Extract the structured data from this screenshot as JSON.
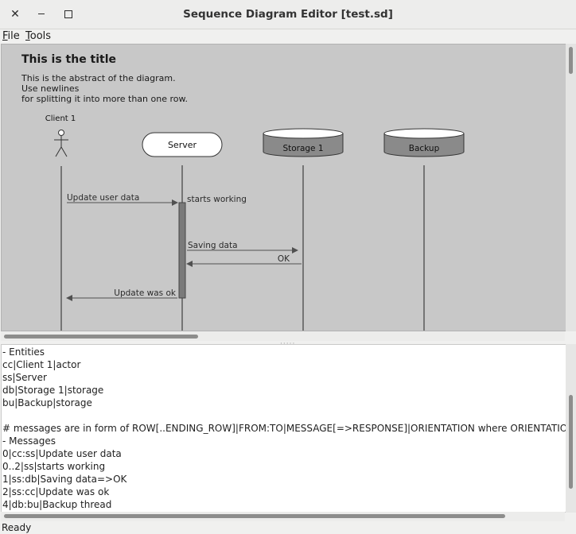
{
  "window": {
    "title": "Sequence Diagram Editor [test.sd]"
  },
  "menu": {
    "file": "File",
    "tools": "Tools"
  },
  "diagram": {
    "title": "This is the title",
    "abstract": [
      "This is the abstract of the diagram.",
      "Use newlines",
      "for splitting it into more than one row."
    ],
    "entities": [
      {
        "label": "Client 1",
        "type": "actor"
      },
      {
        "label": "Server",
        "type": "process"
      },
      {
        "label": "Storage 1",
        "type": "storage"
      },
      {
        "label": "Backup",
        "type": "storage"
      }
    ],
    "messages": [
      "Update user data",
      "starts working",
      "Saving data",
      "OK",
      "Update was ok"
    ]
  },
  "editor": {
    "lines": [
      "- Entities",
      "cc|Client 1|actor",
      "ss|Server",
      "db|Storage 1|storage",
      "bu|Backup|storage",
      "",
      "# messages are in form of ROW[..ENDING_ROW]|FROM:TO|MESSAGE[=>RESPONSE]|ORIENTATION where ORIENTATION =",
      "- Messages",
      "0|cc:ss|Update user data",
      "0..2|ss|starts working",
      "1|ss:db|Saving data=>OK",
      "2|ss:cc|Update was ok",
      "4|db:bu|Backup thread"
    ]
  },
  "status": "Ready"
}
